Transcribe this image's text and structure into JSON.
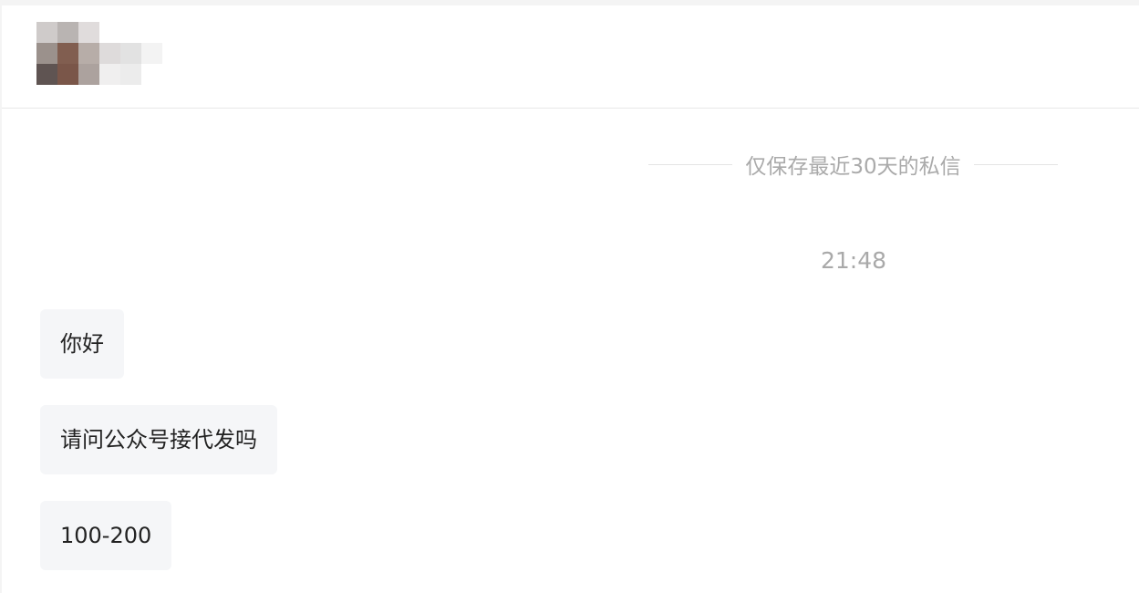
{
  "header": {
    "avatar_pixels": [
      "#cfcbca",
      "#b9b4b2",
      "#e0dcdc",
      "#ffffff",
      "#ffffff",
      "#ffffff",
      "#9b918c",
      "#815e50",
      "#b7ada8",
      "#dedbdb",
      "#e2e2e2",
      "#f3f3f3",
      "#5f5452",
      "#7a5649",
      "#aca29e",
      "#f0efef",
      "#ececec",
      "#ffffff"
    ]
  },
  "chat": {
    "notice": "仅保存最近30天的私信",
    "timestamp": "21:48",
    "messages": [
      {
        "text": "你好"
      },
      {
        "text": "请问公众号接代发吗"
      },
      {
        "text": "100-200"
      }
    ]
  }
}
